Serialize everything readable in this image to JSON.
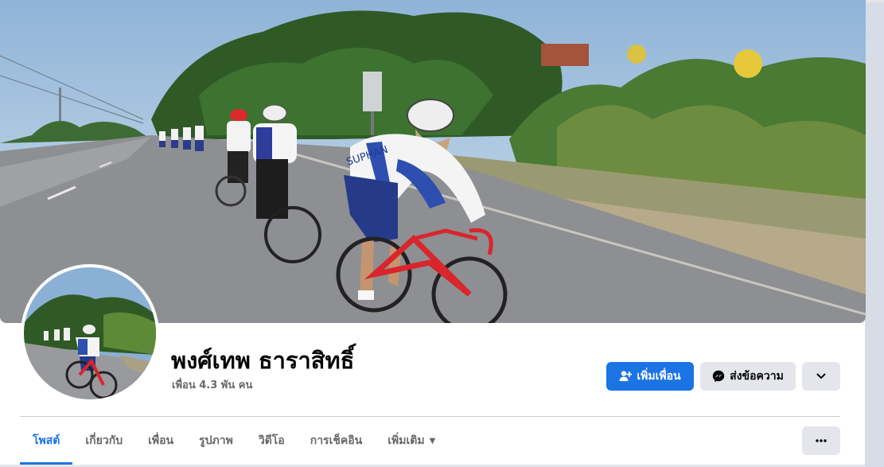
{
  "profile": {
    "name": "พงศ์เทพ ธาราสิทธิ์",
    "friends_text": "เพื่อน 4.3 พัน คน"
  },
  "actions": {
    "add_friend_label": "เพิ่มเพื่อน",
    "message_label": "ส่งข้อความ",
    "more_icon": "chevron-down-icon",
    "options_icon": "more-dots-icon"
  },
  "tabs": [
    {
      "label": "โพสต์",
      "active": true
    },
    {
      "label": "เกี่ยวกับ",
      "active": false
    },
    {
      "label": "เพื่อน",
      "active": false
    },
    {
      "label": "รูปภาพ",
      "active": false
    },
    {
      "label": "วิดีโอ",
      "active": false
    },
    {
      "label": "การเช็คอิน",
      "active": false
    },
    {
      "label": "เพิ่มเติม",
      "active": false,
      "has_dropdown": true
    }
  ],
  "cover_jersey_text": "SUPHAN",
  "colors": {
    "accent": "#1b74e4",
    "button_gray": "#e4e6eb",
    "text_secondary": "#65676b"
  }
}
